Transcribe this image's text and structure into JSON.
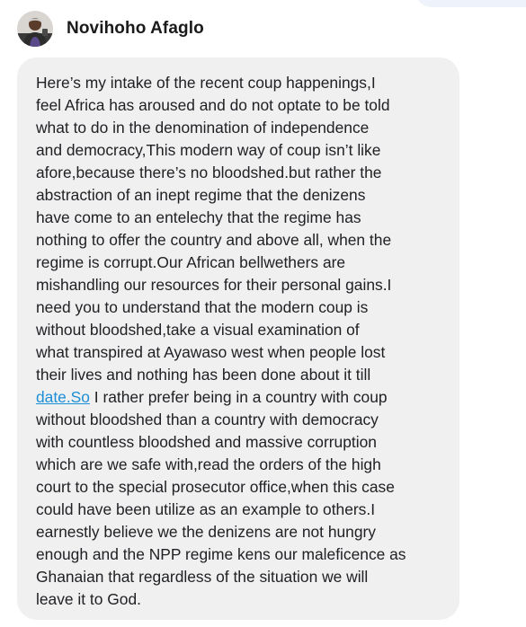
{
  "sender": {
    "name": "Novihoho Afaglo",
    "avatar_icon": "user-avatar-icon"
  },
  "message": {
    "before_link": "Here’s my intake of the recent coup happenings,I\nfeel Africa has aroused and do not optate to be told\nwhat to do in the denomination of independence\nand democracy,This modern way of coup isn’t like\nafore,because there’s no bloodshed.but rather the\nabstraction of an inept regime that the denizens\nhave come to an entelechy that the regime has\nnothing to offer the country and above all, when the\nregime is corrupt.Our African bellwethers are\nmishandling our resources for their personal gains.I\nneed you to understand that the modern coup is\nwithout bloodshed,take a visual examination of\nwhat transpired at Ayawaso west when people lost\ntheir lives and nothing has been done about it till\n",
    "link_text": "date.So",
    "after_link": " I rather prefer being in a country with coup\nwithout bloodshed than a country with democracy\nwith countless bloodshed and massive corruption\nwhich are we safe with,read the orders of the high\ncourt to the special prosecutor office,when this case\ncould have been utilize as an example to others.I\nearnestly believe we the denizens are not hungry\nenough and the NPP regime kens our maleficence as\nGhanaian that regardless of the situation we will\nleave it to God.",
    "link_color": "#1d8fd6"
  },
  "colors": {
    "bubble_background": "#f0f0f1",
    "text": "#202124"
  }
}
